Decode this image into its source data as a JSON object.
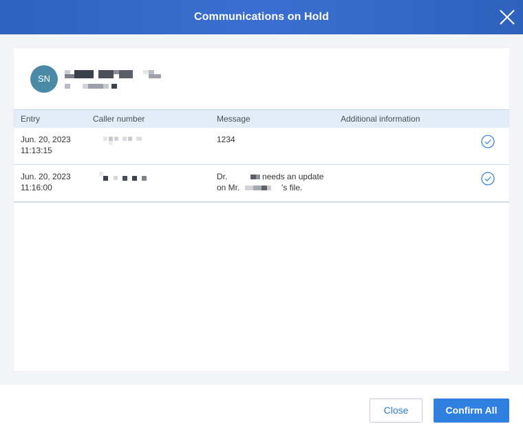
{
  "dialog": {
    "title": "Communications on Hold"
  },
  "contact": {
    "initials": "SN"
  },
  "table": {
    "columns": [
      "Entry",
      "Caller number",
      "Message",
      "Additional information"
    ],
    "rows": [
      {
        "entry_date": "Jun. 20, 2023",
        "entry_time": "11:13:15",
        "message_line1": "1234",
        "message_line2": "",
        "additional": ""
      },
      {
        "entry_date": "Jun. 20, 2023",
        "entry_time": "11:16:00",
        "message_line1_prefix": "Dr.",
        "message_line1_suffix": "needs an update",
        "message_line2_prefix": "on Mr.",
        "message_line2_suffix": "'s file.",
        "additional": ""
      }
    ]
  },
  "footer": {
    "close_label": "Close",
    "confirm_label": "Confirm All"
  },
  "colors": {
    "header": "#3a6fd0",
    "avatar": "#4a8aa6",
    "primary": "#2f80df"
  },
  "icons": {
    "close": "close-icon",
    "confirm_row": "check-circle-icon"
  }
}
